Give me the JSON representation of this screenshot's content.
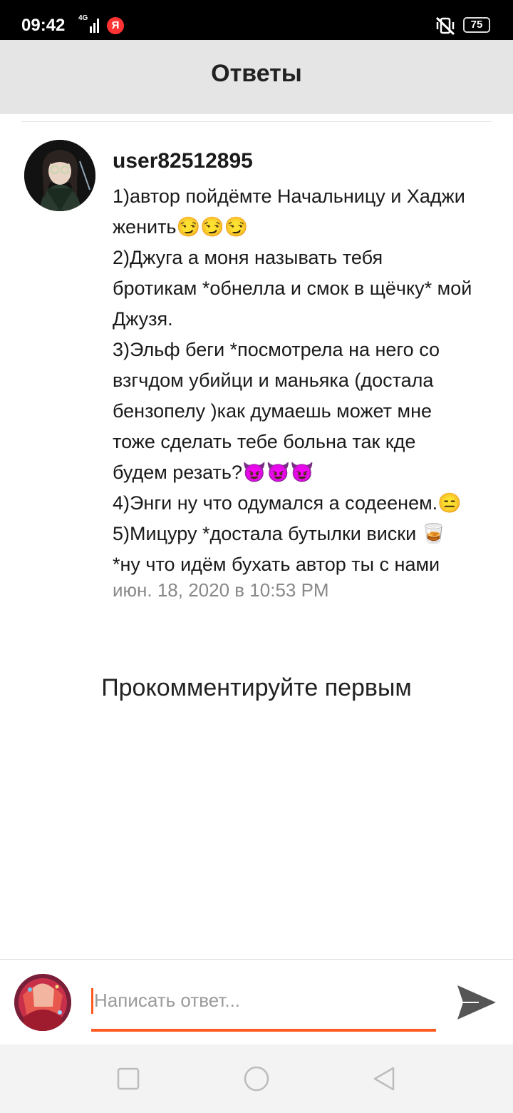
{
  "status_bar": {
    "time": "09:42",
    "network": "4G",
    "yandex": "Я",
    "battery": "75"
  },
  "header": {
    "title": "Ответы"
  },
  "comment": {
    "username": "user82512895",
    "lines": [
      "1)автор пойдёмте Начальницу и Хаджи",
      "женить😏😏😏",
      "2)Джуга а моня называть тебя",
      "бротикам *обнелла и смок в щёчку* мой",
      "Джузя.",
      "3)Эльф беги *посмотрела на него со",
      "взгчдом убийци и маньяка (достала",
      "бензопелу )как думаешь может мне",
      "тоже сделать тебе больна так кде",
      "будем резать?😈😈😈",
      "4)Энги ну что одумался а содеенем.😑",
      "5)Мицуру *достала бутылки виски 🥃",
      "*ну что идём бухать автор ты с нами"
    ],
    "timestamp": "июн. 18, 2020 в 10:53 PM"
  },
  "empty_state": "Прокомментируйте первым",
  "composer": {
    "placeholder": "Написать ответ..."
  },
  "colors": {
    "accent": "#ff5a1f",
    "header_bg": "#e5e5e5",
    "timestamp": "#888888"
  },
  "icons": {
    "send": "send-icon",
    "nav_recent": "square-icon",
    "nav_home": "circle-icon",
    "nav_back": "triangle-back-icon"
  }
}
